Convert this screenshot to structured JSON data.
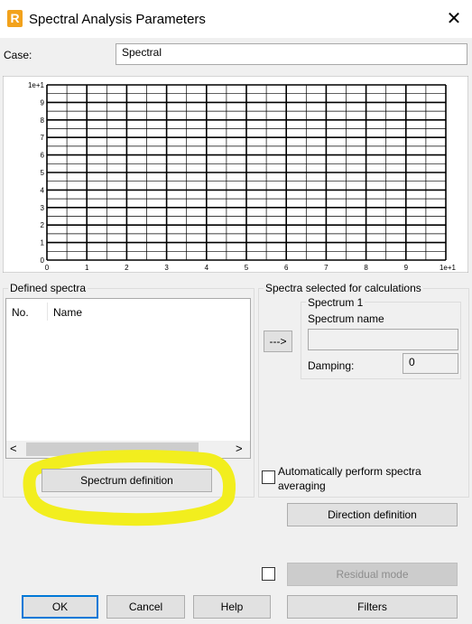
{
  "window": {
    "title": "Spectral Analysis Parameters",
    "close_glyph": "✕",
    "app_icon_letter": "R"
  },
  "case": {
    "label": "Case:",
    "value": "Spectral"
  },
  "chart": {
    "x_ticks": [
      "0",
      "1",
      "2",
      "3",
      "4",
      "5",
      "6",
      "7",
      "8",
      "9",
      "1e+1"
    ],
    "y_ticks": [
      "0",
      "1",
      "2",
      "3",
      "4",
      "5",
      "6",
      "7",
      "8",
      "9",
      "1e+1"
    ]
  },
  "defined_spectra": {
    "title": "Defined spectra",
    "columns": [
      "No.",
      "Name"
    ],
    "rows": [],
    "scroll_left": "<",
    "scroll_right": ">",
    "spectrum_definition_label": "Spectrum definition"
  },
  "transfer_button_label": "--->",
  "selected_spectra": {
    "title": "Spectra selected for calculations",
    "spectrum_group_title": "Spectrum 1",
    "spectrum_name_label": "Spectrum name",
    "spectrum_name_value": "",
    "damping_label": "Damping:",
    "damping_value": "0"
  },
  "auto_average": {
    "label_line1": "Automatically perform spectra",
    "label_line2": "averaging",
    "checked": false
  },
  "direction_definition_label": "Direction definition",
  "residual_mode": {
    "label": "Residual mode",
    "checked": false
  },
  "footer": {
    "ok": "OK",
    "cancel": "Cancel",
    "help": "Help",
    "filters": "Filters"
  },
  "highlight_color": "#f2ee1e"
}
